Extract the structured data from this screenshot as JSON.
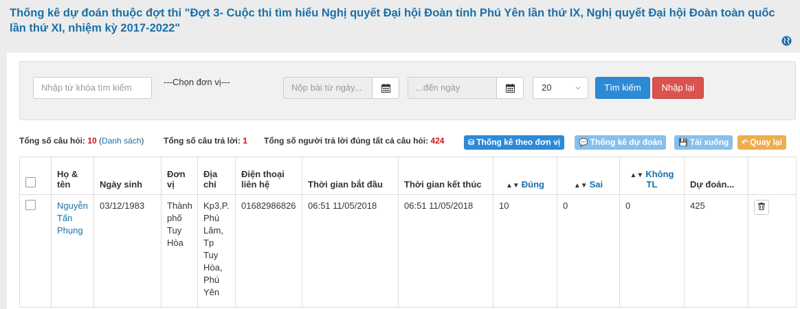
{
  "header": {
    "title": "Thống kê dự đoán thuộc đợt thi \"Đợt 3- Cuộc thi tìm hiểu Nghị quyết Đại hội Đoàn tỉnh Phú Yên lần thứ IX, Nghị quyết Đại hội Đoàn toàn quốc lần thứ XI, nhiệm kỳ 2017-2022\"",
    "globe_icon": "globe-icon"
  },
  "filters": {
    "keyword_placeholder": "Nhập từ khóa tìm kiếm",
    "unit_label": "---Chọn đơn vị---",
    "from_date_placeholder": "Nộp bài từ ngày...",
    "to_date_placeholder": "...đến ngày",
    "calendar_icon": "calendar-icon",
    "page_size": "20",
    "search_label": "Tìm kiếm",
    "reset_label": "Nhập lại"
  },
  "summary": {
    "questions_label": "Tổng số câu hỏi:",
    "questions_value": "10",
    "list_link": "Danh sách",
    "answers_label": "Tổng số câu trả lời:",
    "answers_value": "1",
    "correct_all_label": "Tổng số người trả lời đúng tất cả câu hỏi:",
    "correct_all_value": "424"
  },
  "actions": {
    "by_unit": "Thống kê theo đơn vị",
    "by_prediction": "Thống kê dự đoán",
    "download": "Tải xuống",
    "back": "Quay lại"
  },
  "colors": {
    "title": "#1a6fa8",
    "primary": "#2d8ad6",
    "danger": "#d9534f",
    "info_light": "#86c0ec",
    "warning": "#f0ad4e"
  },
  "table": {
    "headers": {
      "name": "Họ & tên",
      "dob": "Ngày sinh",
      "unit": "Đơn vị",
      "address": "Địa chỉ",
      "phone": "Điện thoại liên hệ",
      "start": "Thời gian bắt đầu",
      "end": "Thời gian kết thúc",
      "correct": "Đúng",
      "wrong": "Sai",
      "no_answer": "Không TL",
      "prediction": "Dự đoán..."
    },
    "rows": [
      {
        "name": "Nguyễn Tấn Phụng",
        "dob": "03/12/1983",
        "unit": "Thành phố Tuy Hòa",
        "address": "Kp3,P. Phú Lâm, Tp Tuy Hòa, Phú Yên",
        "phone": "01682986826",
        "start": "06:51 11/05/2018",
        "end": "06:51 11/05/2018",
        "correct": "10",
        "wrong": "0",
        "no_answer": "0",
        "prediction": "425"
      }
    ]
  }
}
